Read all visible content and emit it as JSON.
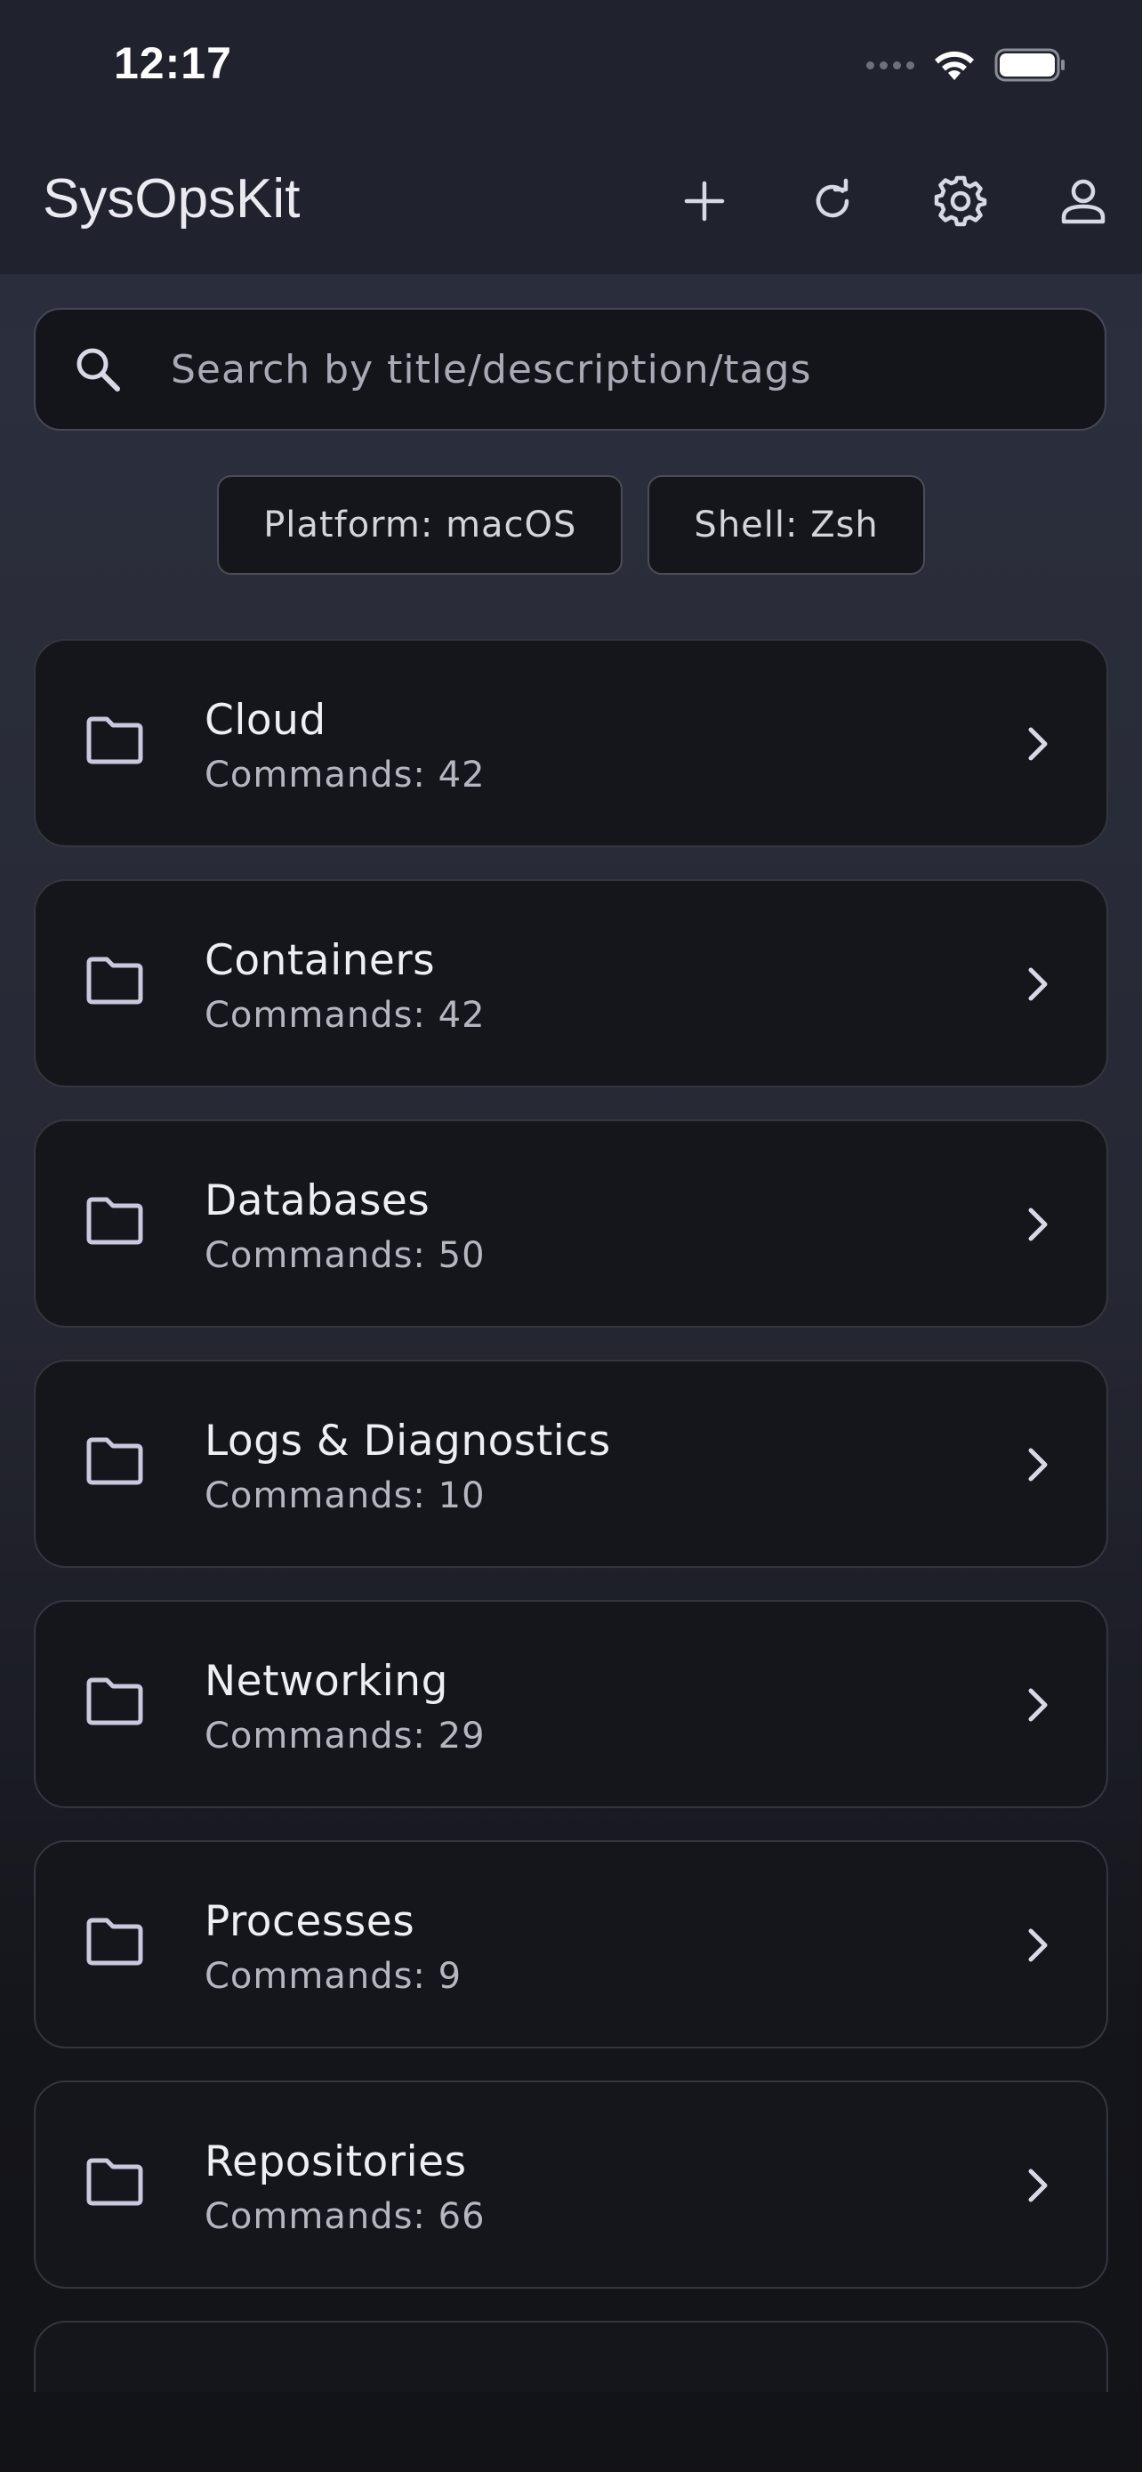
{
  "status_bar": {
    "time": "12:17"
  },
  "app_bar": {
    "title": "SysOpsKit",
    "actions": [
      "plus-icon",
      "refresh-icon",
      "gear-icon",
      "person-icon"
    ]
  },
  "search": {
    "placeholder": "Search by title/description/tags",
    "value": ""
  },
  "filters": [
    {
      "label": "Platform: macOS"
    },
    {
      "label": "Shell: Zsh"
    }
  ],
  "categories": [
    {
      "name": "Cloud",
      "count_text": "Commands: 42"
    },
    {
      "name": "Containers",
      "count_text": "Commands: 42"
    },
    {
      "name": "Databases",
      "count_text": "Commands: 50"
    },
    {
      "name": "Logs & Diagnostics",
      "count_text": "Commands: 10"
    },
    {
      "name": "Networking",
      "count_text": "Commands: 29"
    },
    {
      "name": "Processes",
      "count_text": "Commands: 9"
    },
    {
      "name": "Repositories",
      "count_text": "Commands: 66"
    }
  ],
  "colors": {
    "app_bar_bg": "#20222d",
    "card_bg": "#15161c",
    "icon": "#d8d9e6",
    "folder_icon": "#c8c9dc"
  }
}
